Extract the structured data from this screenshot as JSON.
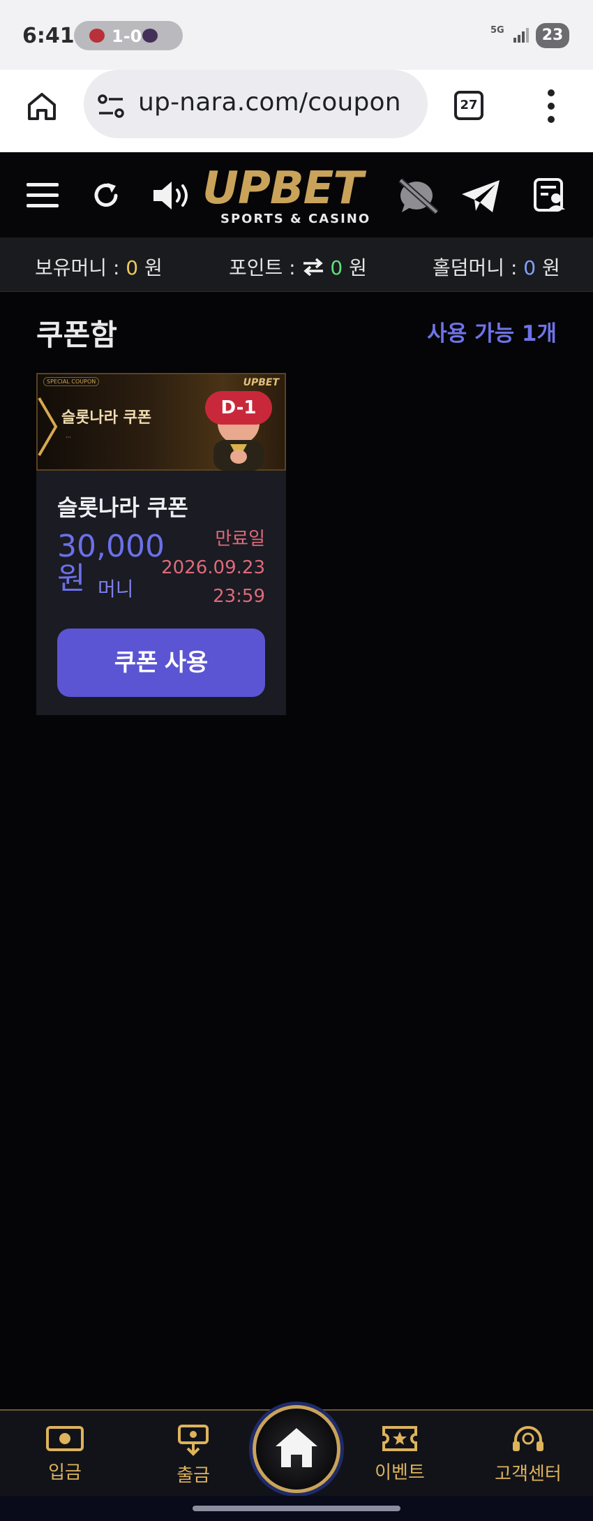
{
  "status_bar": {
    "time": "6:41",
    "score": "1-0",
    "network": "5G",
    "battery": "23"
  },
  "browser": {
    "url": "up-nara.com/coupon",
    "tab_count": "27"
  },
  "header": {
    "logo": "UPBET",
    "logo_sub": "SPORTS & CASINO"
  },
  "balance": {
    "money_label": "보유머니 : ",
    "money_value": "0",
    "money_unit": " 원",
    "point_label": "포인트 : ",
    "point_value": "0",
    "point_unit": " 원",
    "holdem_label": "홀덤머니 : ",
    "holdem_value": "0",
    "holdem_unit": " 원"
  },
  "coupons": {
    "title": "쿠폰함",
    "available": "사용 가능 1개",
    "items": [
      {
        "banner_tag": "SPECIAL COUPON",
        "banner_title": "슬롯나라 쿠폰",
        "banner_logo": "UPBET",
        "dday": "D-1",
        "name": "슬롯나라 쿠폰",
        "amount": "30,000원",
        "unit": "머니",
        "expiry_label": "만료일",
        "expiry_date": "2026.09.23",
        "expiry_time": "23:59",
        "button": "쿠폰 사용"
      }
    ]
  },
  "bottom_nav": {
    "deposit": "입금",
    "withdraw": "출금",
    "event": "이벤트",
    "support": "고객센터"
  },
  "colors": {
    "accent": "#5b55d3",
    "gold": "#c9a35a",
    "expiry": "#e06a78"
  }
}
